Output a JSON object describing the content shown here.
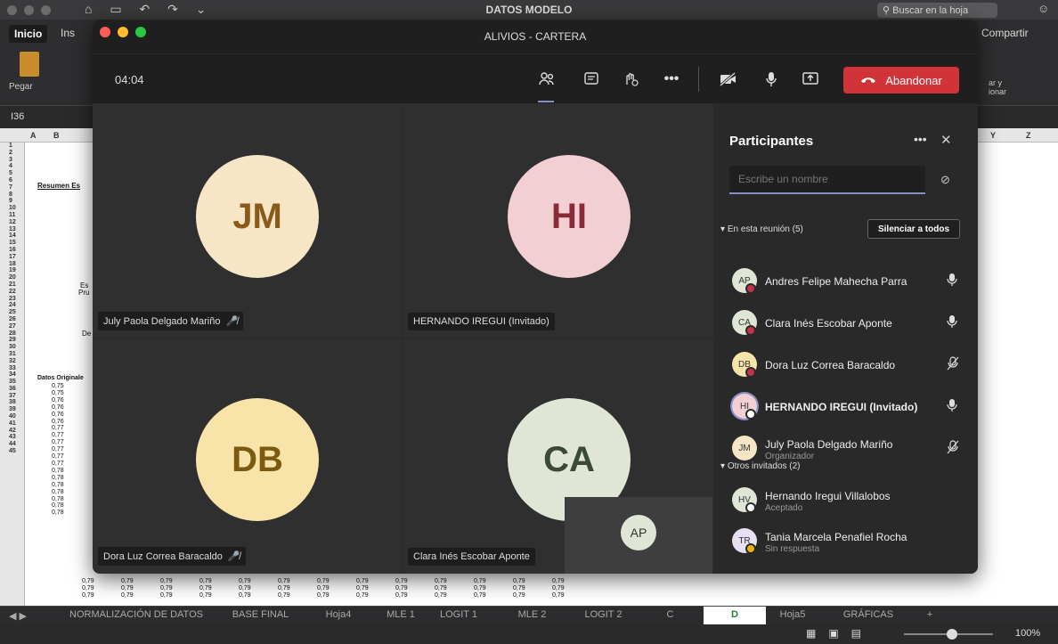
{
  "excel": {
    "title": "DATOS MODELO",
    "search_placeholder": "Buscar en la hoja",
    "tabs": {
      "inicio": "Inicio",
      "insertar": "Ins"
    },
    "compartir": "Compartir",
    "pegar": "Pegar",
    "ordenar": "ar y\nionar",
    "cell_ref": "I36",
    "col_headers": [
      "A",
      "B",
      "Y",
      "Z"
    ],
    "row_numbers": [
      "1",
      "2",
      "3",
      "4",
      "5",
      "6",
      "7",
      "8",
      "9",
      "10",
      "11",
      "12",
      "13",
      "14",
      "15",
      "16",
      "17",
      "18",
      "19",
      "20",
      "21",
      "22",
      "23",
      "24",
      "25",
      "26",
      "27",
      "28",
      "29",
      "30",
      "31",
      "32",
      "33",
      "34",
      "35",
      "36",
      "37",
      "38",
      "39",
      "40",
      "41",
      "42",
      "43",
      "44",
      "45"
    ],
    "resumen": "Resumen Es",
    "es_label": "Es",
    "pru_label": "Pru",
    "de_label": "De",
    "datos_originales": "Datos Originale",
    "values": [
      "0,75",
      "0,75",
      "0,76",
      "0,76",
      "0,76",
      "0,76",
      "0,77",
      "0,77",
      "0,77",
      "0,77",
      "0,77",
      "0,77",
      "0,78",
      "0,78",
      "0,78",
      "0,78",
      "0,78",
      "0,78",
      "0,78"
    ],
    "bottom_rows": [
      [
        "0,79",
        "0,79",
        "0,79",
        "0,79",
        "0,79",
        "0,79",
        "0,79",
        "0,79",
        "0,79",
        "0,79",
        "0,79",
        "0,79",
        "0,79"
      ],
      [
        "0,79",
        "0,79",
        "0,79",
        "0,79",
        "0,79",
        "0,79",
        "0,79",
        "0,79",
        "0,79",
        "0,79",
        "0,79",
        "0,79",
        "0,79"
      ],
      [
        "0,79",
        "0,79",
        "0,79",
        "0,79",
        "0,79",
        "0,79",
        "0,79",
        "0,79",
        "0,79",
        "0,79",
        "0,79",
        "0,79",
        "0,79"
      ]
    ],
    "sheet_tabs": [
      "NORMALIZACIÓN DE DATOS",
      "BASE FINAL",
      "Hoja4",
      "MLE 1",
      "LOGIT 1",
      "MLE 2",
      "LOGIT 2",
      "C",
      "D",
      "Hoja5",
      "GRÁFICAS",
      "+"
    ],
    "active_sheet": "D",
    "zoom": "100%"
  },
  "teams": {
    "window_title": "ALIVIOS - CARTERA",
    "timer": "04:04",
    "leave_label": "Abandonar",
    "tiles": [
      {
        "initials": "JM",
        "name": "July Paola Delgado Mariño",
        "muted": true,
        "color": "#f7e6c6",
        "text_color": "#8a5a1a"
      },
      {
        "initials": "HI",
        "name": "HERNANDO IREGUI (Invitado)",
        "muted": false,
        "color": "#f1cfd2",
        "text_color": "#8a2a38"
      },
      {
        "initials": "DB",
        "name": "Dora Luz Correa Baracaldo",
        "muted": true,
        "color": "#f8e4a8",
        "text_color": "#7a5a10"
      },
      {
        "initials": "CA",
        "name": "Clara Inés Escobar Aponte",
        "muted": false,
        "color": "#dfe6d6",
        "text_color": "#3a4a33"
      }
    ],
    "small_tile": {
      "initials": "AP"
    },
    "panel": {
      "title": "Participantes",
      "search_placeholder": "Escribe un nombre",
      "in_meeting_label": "En esta reunión (5)",
      "mute_all_label": "Silenciar a todos",
      "others_label": "Otros invitados (2)",
      "in_meeting": [
        {
          "initials": "AP",
          "name": "Andres Felipe Mahecha Parra",
          "sub": "",
          "mic": "on",
          "av_color": "#dfe6d6",
          "dot": "#c4314b"
        },
        {
          "initials": "CA",
          "name": "Clara Inés Escobar Aponte",
          "sub": "",
          "mic": "on",
          "av_color": "#dfe6d6",
          "dot": "#c4314b"
        },
        {
          "initials": "DB",
          "name": "Dora Luz Correa Baracaldo",
          "sub": "",
          "mic": "off",
          "av_color": "#f8e4a8",
          "dot": "#c4314b"
        },
        {
          "initials": "HI",
          "name": "HERNANDO IREGUI (Invitado)",
          "sub": "",
          "mic": "on",
          "av_color": "#f1cfd2",
          "dot": "#ffffff"
        },
        {
          "initials": "JM",
          "name": "July Paola Delgado Mariño",
          "sub": "Organizador",
          "mic": "off",
          "av_color": "#f7e6c6",
          "dot": ""
        }
      ],
      "others": [
        {
          "initials": "HV",
          "name": "Hernando Iregui Villalobos",
          "sub": "Aceptado",
          "av_color": "#dfe6d6",
          "dot": "#ffffff"
        },
        {
          "initials": "TR",
          "name": "Tania Marcela Penafiel Rocha",
          "sub": "Sin respuesta",
          "av_color": "#e6e0f2",
          "dot": "#f2b100"
        }
      ]
    }
  }
}
